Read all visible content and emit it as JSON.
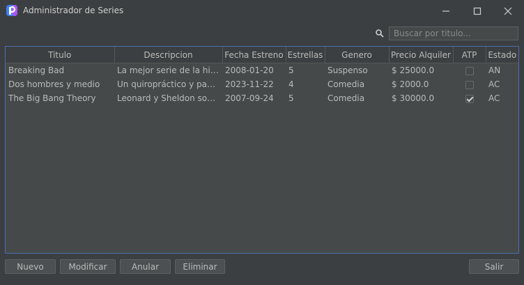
{
  "window": {
    "title": "Administrador de Series"
  },
  "search": {
    "placeholder": "Buscar por titulo...",
    "value": ""
  },
  "table": {
    "columns": [
      "Titulo",
      "Descripcion",
      "Fecha Estreno",
      "Estrellas",
      "Genero",
      "Precio Alquiler",
      "ATP",
      "Estado"
    ],
    "rows": [
      {
        "titulo": "Breaking Bad",
        "descripcion": "La mejor serie de la historia",
        "fecha": "2008-01-20",
        "estrellas": "5",
        "genero": "Suspenso",
        "precio": "$ 25000.0",
        "atp": false,
        "estado": "AN"
      },
      {
        "titulo": "Dos hombres y medio",
        "descripcion": "Un quiropráctico y padre s...",
        "fecha": "2023-11-22",
        "estrellas": "4",
        "genero": "Comedia",
        "precio": "$ 2000.0",
        "atp": false,
        "estado": "AC"
      },
      {
        "titulo": "The Big Bang Theory",
        "descripcion": "Leonard y Sheldon son do...",
        "fecha": "2007-09-24",
        "estrellas": "5",
        "genero": "Comedia",
        "precio": "$ 30000.0",
        "atp": true,
        "estado": "AC"
      }
    ]
  },
  "buttons": {
    "nuevo": "Nuevo",
    "modificar": "Modificar",
    "anular": "Anular",
    "eliminar": "Eliminar",
    "salir": "Salir"
  },
  "colors": {
    "background": "#3c3f41",
    "table_background": "#45494a",
    "table_border": "#4b6eaf",
    "app_icon": "#5a8dee"
  }
}
